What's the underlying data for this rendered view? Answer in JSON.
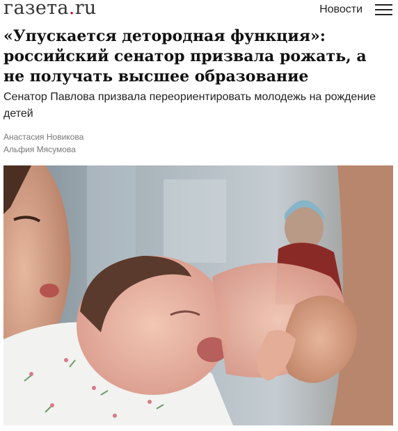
{
  "header": {
    "logo_text": "газета",
    "logo_dot": ".",
    "logo_tld": "ru",
    "nav_link": "Новости",
    "menu_icon": "hamburger-menu-icon"
  },
  "article": {
    "title": "«Упускается детородная функция»: российский сенатор призвала рожать, а не получать высшее образование",
    "subtitle": "Сенатор Павлова призвала переориентировать молодежь на рождение детей",
    "authors": [
      "Анастасия Новикова",
      "Альфия Мясумова"
    ],
    "image": "photo: mother kissing a newborn baby"
  },
  "colors": {
    "logo_dot": "#d0021b",
    "text": "#111111",
    "meta": "#777777"
  }
}
